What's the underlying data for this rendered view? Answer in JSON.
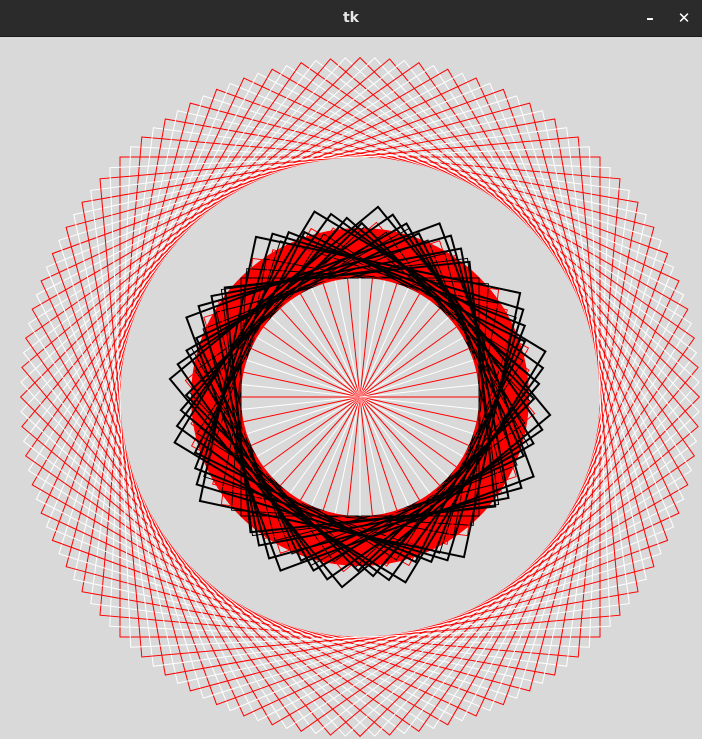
{
  "window": {
    "title": "tk",
    "minimize_glyph": "–",
    "close_glyph": "✕"
  },
  "canvas": {
    "background": "#d9d9d9",
    "colors": {
      "red": "#ff0000",
      "white": "#ffffff",
      "black": "#000000"
    }
  }
}
